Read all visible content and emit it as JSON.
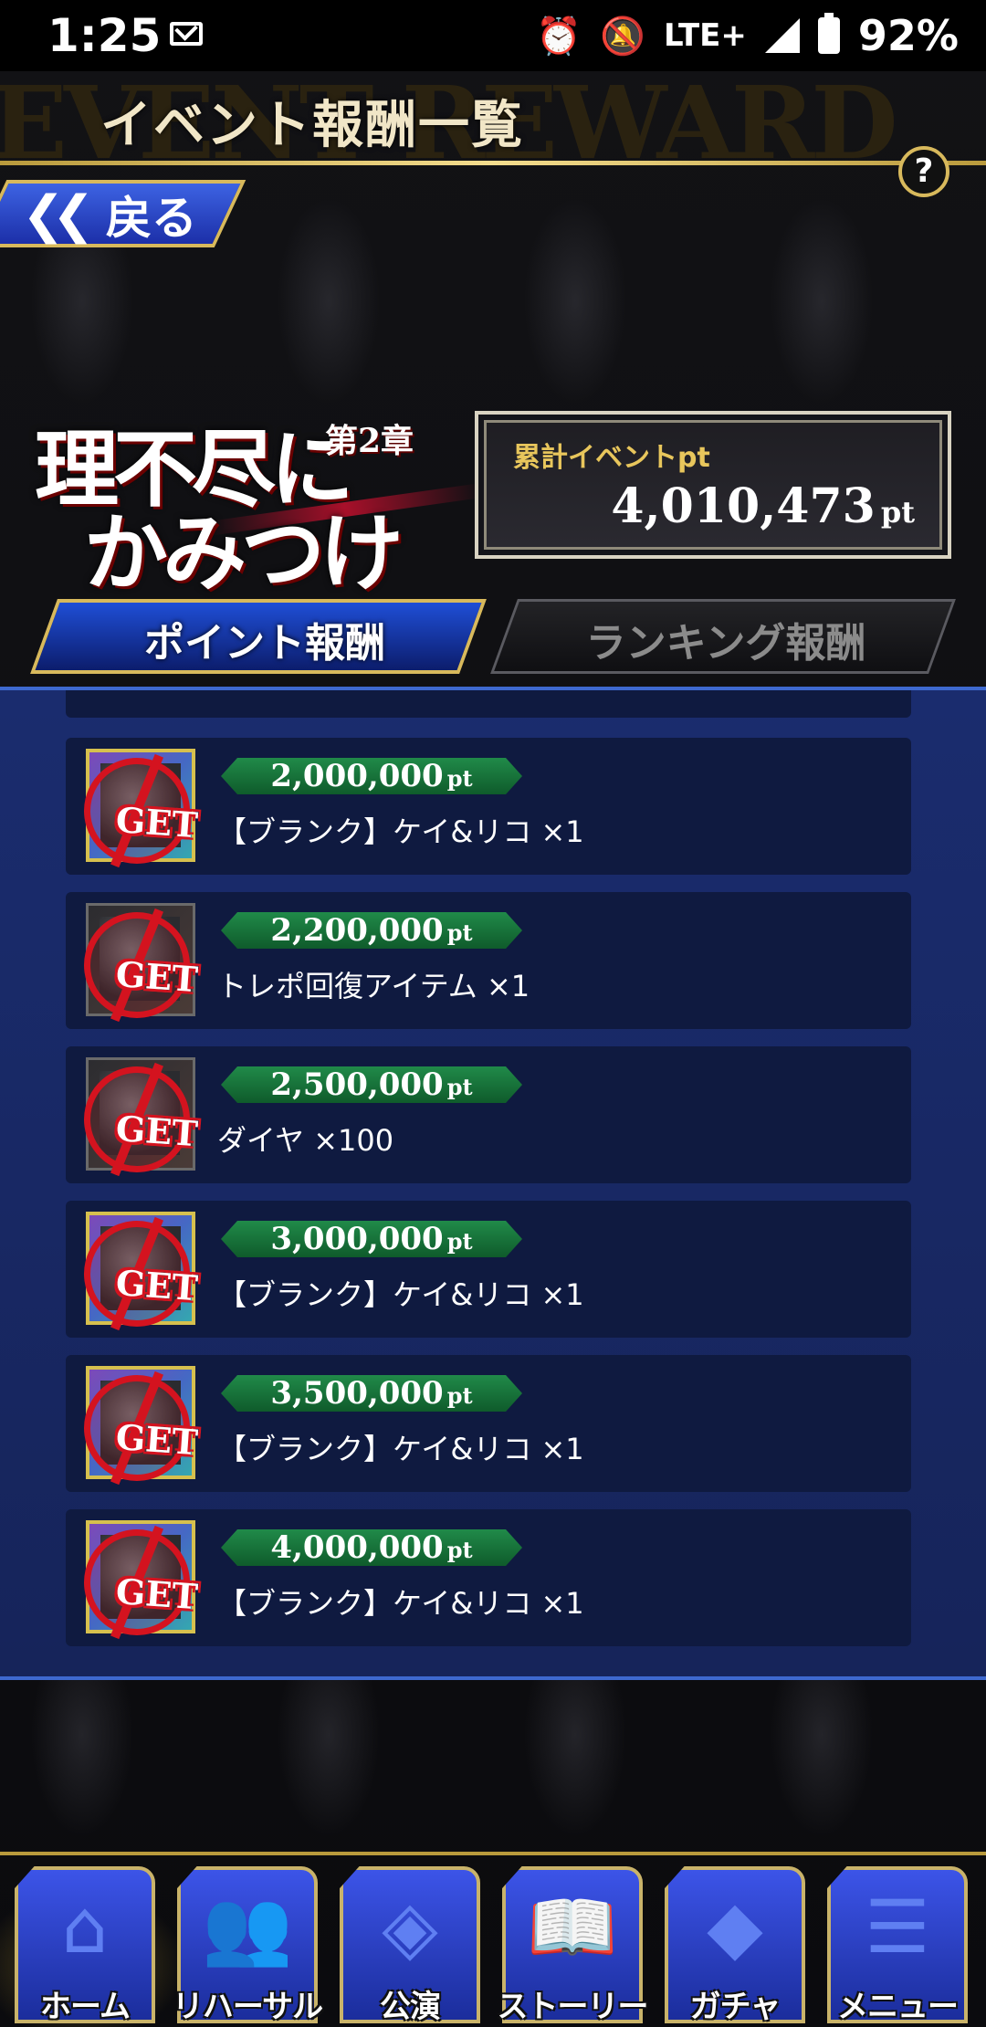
{
  "status_bar": {
    "time": "1:25",
    "network": "LTE+",
    "battery": "92%",
    "icons": [
      "mail-icon",
      "alarm-icon",
      "bell-off-icon",
      "signal-icon",
      "battery-charging-icon"
    ]
  },
  "header": {
    "bg_text": "EVENT REWARD",
    "title": "イベント報酬一覧",
    "back_label": "戻る",
    "help_label": "?"
  },
  "event": {
    "logo_line1": "理不尽に",
    "logo_chapter": "第2章",
    "logo_line2": "かみつけ",
    "points_label": "累計イベントpt",
    "points_value": "4,010,473",
    "points_unit": "pt"
  },
  "tabs": [
    {
      "label": "ポイント報酬",
      "active": true
    },
    {
      "label": "ランキング報酬",
      "active": false
    }
  ],
  "rewards": [
    {
      "points": "2,000,000",
      "unit": "pt",
      "name": "【ブランク】ケイ&リコ ×1",
      "stamp": "GET",
      "kind": "card"
    },
    {
      "points": "2,200,000",
      "unit": "pt",
      "name": "トレポ回復アイテム ×1",
      "stamp": "GET",
      "kind": "item"
    },
    {
      "points": "2,500,000",
      "unit": "pt",
      "name": "ダイヤ ×100",
      "stamp": "GET",
      "kind": "item"
    },
    {
      "points": "3,000,000",
      "unit": "pt",
      "name": "【ブランク】ケイ&リコ ×1",
      "stamp": "GET",
      "kind": "card"
    },
    {
      "points": "3,500,000",
      "unit": "pt",
      "name": "【ブランク】ケイ&リコ ×1",
      "stamp": "GET",
      "kind": "card"
    },
    {
      "points": "4,000,000",
      "unit": "pt",
      "name": "【ブランク】ケイ&リコ ×1",
      "stamp": "GET",
      "kind": "card"
    }
  ],
  "nav": [
    {
      "label": "ホーム",
      "icon": "home-icon",
      "glyph": "⌂"
    },
    {
      "label": "リハーサル",
      "icon": "rehearsal-icon",
      "glyph": "👥"
    },
    {
      "label": "公演",
      "icon": "stage-icon",
      "glyph": "◈"
    },
    {
      "label": "ストーリー",
      "icon": "story-icon",
      "glyph": "📖"
    },
    {
      "label": "ガチャ",
      "icon": "gacha-icon",
      "glyph": "◆"
    },
    {
      "label": "メニュー",
      "icon": "menu-icon",
      "glyph": "☰"
    }
  ]
}
